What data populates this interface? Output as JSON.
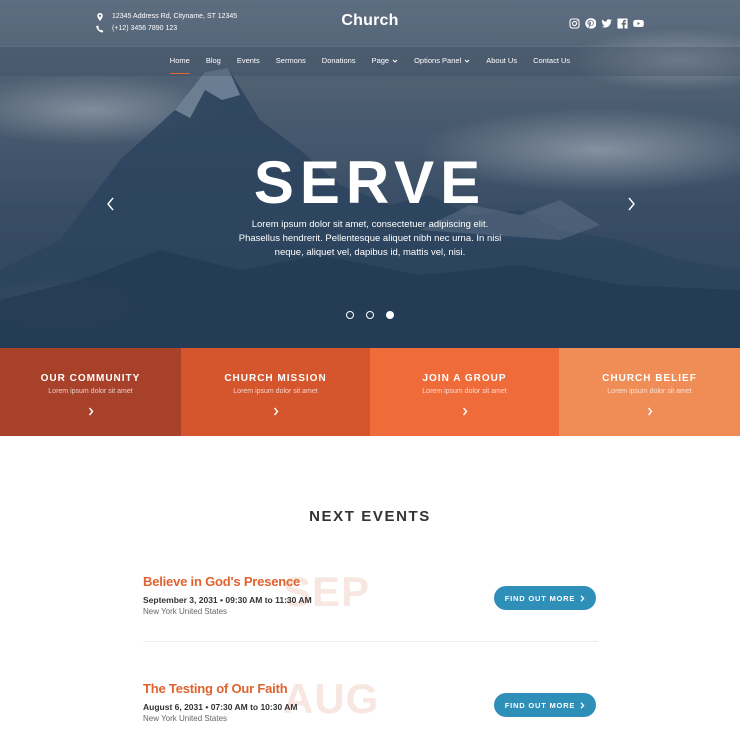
{
  "topbar": {
    "address": "12345 Address Rd, Cityname, ST 12345",
    "phone": "(+12) 3456 7890 123",
    "logo": "Church",
    "social": [
      "instagram-icon",
      "pinterest-icon",
      "twitter-icon",
      "facebook-icon",
      "youtube-icon"
    ]
  },
  "nav": {
    "items": [
      {
        "label": "Home",
        "active": true
      },
      {
        "label": "Blog"
      },
      {
        "label": "Events"
      },
      {
        "label": "Sermons"
      },
      {
        "label": "Donations"
      },
      {
        "label": "Page",
        "dropdown": true
      },
      {
        "label": "Options Panel",
        "dropdown": true
      },
      {
        "label": "About Us"
      },
      {
        "label": "Contact Us"
      }
    ]
  },
  "hero": {
    "title": "SERVE",
    "text": "Lorem ipsum dolor sit amet, consectetuer adipiscing elit. Phasellus hendrerit. Pellentesque aliquet nibh nec urna. In nisi neque, aliquet vel, dapibus id, mattis vel, nisi.",
    "slides": 3,
    "active_slide": 3
  },
  "features": [
    {
      "title": "OUR COMMUNITY",
      "text": "Lorem ipsum dolor sit amet",
      "color": "#a8412a"
    },
    {
      "title": "CHURCH MISSION",
      "text": "Lorem ipsum dolor sit amet",
      "color": "#d5552d"
    },
    {
      "title": "JOIN A GROUP",
      "text": "Lorem ipsum dolor sit amet",
      "color": "#ef6c3a"
    },
    {
      "title": "CHURCH BELIEF",
      "text": "Lorem ipsum dolor sit amet",
      "color": "#f08c55"
    }
  ],
  "events": {
    "heading": "NEXT EVENTS",
    "items": [
      {
        "title": "Believe in God's Presence",
        "ghost": "SEP",
        "date": "September 3, 2031",
        "time": "09:30 AM to 11:30 AM",
        "location": "New York United States",
        "button": "FIND OUT MORE"
      },
      {
        "title": "The Testing of Our Faith",
        "ghost": "AUG",
        "date": "August 6, 2031",
        "time": "07:30 AM to 10:30 AM",
        "location": "New York United States",
        "button": "FIND OUT MORE"
      }
    ]
  },
  "colors": {
    "accent": "#e0622f",
    "button": "#2e90b8"
  }
}
